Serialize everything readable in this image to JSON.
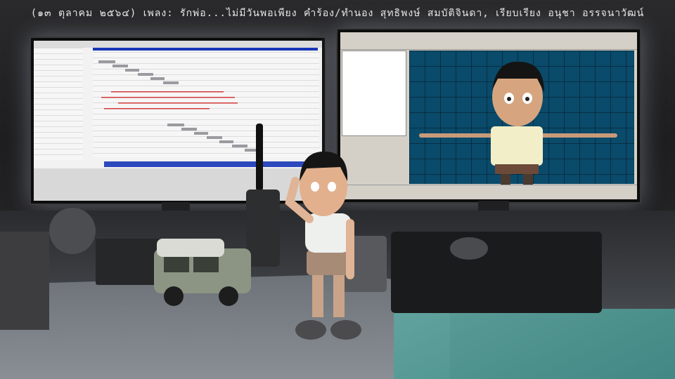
{
  "caption": "(๑๓ ตุลาคม ๒๕๖๔) เพลง: รักพ่อ...ไม่มีวันพอเพียง คำร้อง/ทำนอง สุทธิพงษ์ สมบัติจินดา, เรียบเรียง อนุชา อรรจนาวัฒน์"
}
